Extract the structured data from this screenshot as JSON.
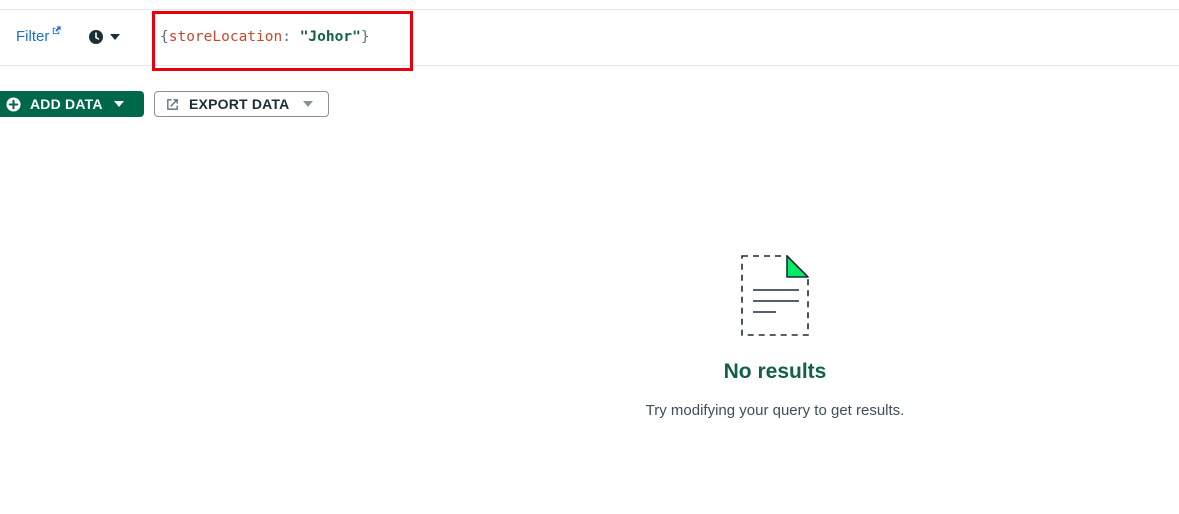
{
  "filter_bar": {
    "filter_label": "Filter",
    "external_icon": "external-link-icon",
    "history_icon": "clock-icon",
    "query": {
      "open_brace": "{",
      "key": "storeLocation",
      "colon": ": ",
      "value": "\"Johor\"",
      "close_brace": "}"
    },
    "highlight_color": "#e8000b"
  },
  "toolbar": {
    "add_data_label": "ADD DATA",
    "add_data_icon": "plus-circle-icon",
    "export_data_label": "EXPORT DATA",
    "export_data_icon": "export-icon"
  },
  "empty_state": {
    "icon": "empty-document-icon",
    "title": "No results",
    "description": "Try modifying your query to get results."
  },
  "colors": {
    "brand_green": "#00684a",
    "dark_green": "#116149",
    "link_blue": "#1f6fc5",
    "accent_green": "#00ed64"
  }
}
